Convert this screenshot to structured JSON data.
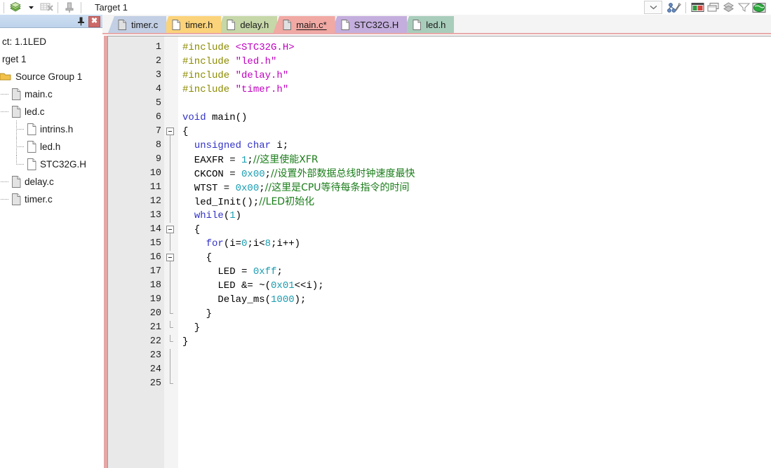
{
  "toolbar": {
    "target_label": "Target 1",
    "buttons": [
      {
        "name": "build-icon",
        "title": "Build"
      },
      {
        "name": "dropdown-arrow-icon",
        "title": "Build options"
      },
      {
        "name": "batch-build-icon",
        "title": "Batch Build"
      },
      {
        "name": "pin-tool-icon",
        "title": "Pin"
      }
    ],
    "right_buttons": [
      {
        "name": "combo-dropdown-icon",
        "title": "Select Target"
      },
      {
        "name": "target-options-icon",
        "title": "Options for Target"
      },
      {
        "name": "project-window-icon",
        "title": "Project Window"
      },
      {
        "name": "books-window-icon",
        "title": "Books Window"
      },
      {
        "name": "functions-window-icon",
        "title": "Functions Window"
      },
      {
        "name": "templates-window-icon",
        "title": "Templates Window"
      },
      {
        "name": "source-browser-icon",
        "title": "Source Browser"
      }
    ]
  },
  "sidebar": {
    "pin_label": "",
    "close_label": "✖",
    "tree": [
      {
        "label": "ct: 1.1LED",
        "indent": 0,
        "icon": "none",
        "connector": "none"
      },
      {
        "label": "rget 1",
        "indent": 0,
        "icon": "none",
        "connector": "none"
      },
      {
        "label": "Source Group 1",
        "indent": 0,
        "icon": "folder",
        "connector": "none"
      },
      {
        "label": "main.c",
        "indent": 1,
        "icon": "doc-src",
        "connector": "expand"
      },
      {
        "label": "led.c",
        "indent": 1,
        "icon": "doc-src",
        "connector": "expand"
      },
      {
        "label": "intrins.h",
        "indent": 2,
        "icon": "doc-hdr",
        "connector": "tee"
      },
      {
        "label": "led.h",
        "indent": 2,
        "icon": "doc-hdr",
        "connector": "tee"
      },
      {
        "label": "STC32G.H",
        "indent": 2,
        "icon": "doc-hdr",
        "connector": "end"
      },
      {
        "label": "delay.c",
        "indent": 1,
        "icon": "doc-src",
        "connector": "expand"
      },
      {
        "label": "timer.c",
        "indent": 1,
        "icon": "doc-src",
        "connector": "expand"
      }
    ]
  },
  "tabs": [
    {
      "label": "timer.c",
      "color": "#c2cfe4",
      "active": false
    },
    {
      "label": "timer.h",
      "color": "#fbd37a",
      "active": false
    },
    {
      "label": "delay.h",
      "color": "#c6d7a8",
      "active": false
    },
    {
      "label": "main.c*",
      "color": "#f1a9a4",
      "active": true
    },
    {
      "label": "STC32G.H",
      "color": "#c4aedd",
      "active": false
    },
    {
      "label": "led.h",
      "color": "#a8cdbb",
      "active": false
    }
  ],
  "editor": {
    "line_count": 25,
    "line_numbers": [
      "1",
      "2",
      "3",
      "4",
      "5",
      "6",
      "7",
      "8",
      "9",
      "10",
      "11",
      "12",
      "13",
      "14",
      "15",
      "16",
      "17",
      "18",
      "19",
      "20",
      "21",
      "22",
      "23",
      "24",
      "25"
    ],
    "fold_marks": {
      "7": "box",
      "8": "v",
      "9": "v",
      "10": "v",
      "11": "v",
      "12": "v",
      "13": "v",
      "14": "box",
      "15": "v",
      "16": "box",
      "17": "v",
      "18": "v",
      "19": "v",
      "20": "end-inner",
      "21": "end-mid",
      "22": "end-outer",
      "23": "v",
      "24": "v",
      "25": "end"
    },
    "lines": [
      {
        "n": 1,
        "tokens": [
          {
            "t": "pre",
            "v": "#include "
          },
          {
            "t": "str",
            "v": "<STC32G.H>"
          }
        ]
      },
      {
        "n": 2,
        "tokens": [
          {
            "t": "pre",
            "v": "#include "
          },
          {
            "t": "str",
            "v": "\"led.h\""
          }
        ]
      },
      {
        "n": 3,
        "tokens": [
          {
            "t": "pre",
            "v": "#include "
          },
          {
            "t": "str",
            "v": "\"delay.h\""
          }
        ]
      },
      {
        "n": 4,
        "tokens": [
          {
            "t": "pre",
            "v": "#include "
          },
          {
            "t": "str",
            "v": "\"timer.h\""
          }
        ]
      },
      {
        "n": 5,
        "tokens": []
      },
      {
        "n": 6,
        "tokens": [
          {
            "t": "kw",
            "v": "void"
          },
          {
            "t": "plain",
            "v": " main()"
          }
        ]
      },
      {
        "n": 7,
        "tokens": [
          {
            "t": "plain",
            "v": "{"
          }
        ]
      },
      {
        "n": 8,
        "tokens": [
          {
            "t": "plain",
            "v": "  "
          },
          {
            "t": "kw",
            "v": "unsigned char"
          },
          {
            "t": "plain",
            "v": " i;"
          }
        ]
      },
      {
        "n": 9,
        "tokens": [
          {
            "t": "plain",
            "v": "  EAXFR = "
          },
          {
            "t": "num",
            "v": "1"
          },
          {
            "t": "plain",
            "v": ";"
          },
          {
            "t": "com",
            "v": "//这里使能XFR"
          }
        ]
      },
      {
        "n": 10,
        "tokens": [
          {
            "t": "plain",
            "v": "  CKCON = "
          },
          {
            "t": "num",
            "v": "0x00"
          },
          {
            "t": "plain",
            "v": ";"
          },
          {
            "t": "com",
            "v": "//设置外部数据总线时钟速度最快"
          }
        ]
      },
      {
        "n": 11,
        "tokens": [
          {
            "t": "plain",
            "v": "  WTST = "
          },
          {
            "t": "num",
            "v": "0x00"
          },
          {
            "t": "plain",
            "v": ";"
          },
          {
            "t": "com",
            "v": "//这里是CPU等待每条指令的时间"
          }
        ]
      },
      {
        "n": 12,
        "tokens": [
          {
            "t": "plain",
            "v": "  led_Init();"
          },
          {
            "t": "com",
            "v": "//LED初始化"
          }
        ]
      },
      {
        "n": 13,
        "tokens": [
          {
            "t": "plain",
            "v": "  "
          },
          {
            "t": "kw",
            "v": "while"
          },
          {
            "t": "plain",
            "v": "("
          },
          {
            "t": "num",
            "v": "1"
          },
          {
            "t": "plain",
            "v": ")"
          }
        ]
      },
      {
        "n": 14,
        "tokens": [
          {
            "t": "plain",
            "v": "  {"
          }
        ]
      },
      {
        "n": 15,
        "tokens": [
          {
            "t": "plain",
            "v": "    "
          },
          {
            "t": "kw",
            "v": "for"
          },
          {
            "t": "plain",
            "v": "(i="
          },
          {
            "t": "num",
            "v": "0"
          },
          {
            "t": "plain",
            "v": ";i<"
          },
          {
            "t": "num",
            "v": "8"
          },
          {
            "t": "plain",
            "v": ";i++)"
          }
        ]
      },
      {
        "n": 16,
        "tokens": [
          {
            "t": "plain",
            "v": "    {"
          }
        ]
      },
      {
        "n": 17,
        "tokens": [
          {
            "t": "plain",
            "v": "      LED = "
          },
          {
            "t": "num",
            "v": "0xff"
          },
          {
            "t": "plain",
            "v": ";"
          }
        ]
      },
      {
        "n": 18,
        "tokens": [
          {
            "t": "plain",
            "v": "      LED &= ~("
          },
          {
            "t": "num",
            "v": "0x01"
          },
          {
            "t": "plain",
            "v": "<<i);"
          }
        ]
      },
      {
        "n": 19,
        "tokens": [
          {
            "t": "plain",
            "v": "      Delay_ms("
          },
          {
            "t": "num",
            "v": "1000"
          },
          {
            "t": "plain",
            "v": ");"
          }
        ]
      },
      {
        "n": 20,
        "tokens": [
          {
            "t": "plain",
            "v": "    }"
          }
        ]
      },
      {
        "n": 21,
        "tokens": [
          {
            "t": "plain",
            "v": "  }"
          }
        ]
      },
      {
        "n": 22,
        "tokens": [
          {
            "t": "plain",
            "v": "}"
          }
        ]
      },
      {
        "n": 23,
        "tokens": []
      },
      {
        "n": 24,
        "tokens": []
      },
      {
        "n": 25,
        "tokens": []
      }
    ]
  },
  "colors": {
    "preprocessor": "#8b8b00",
    "string": "#c000c0",
    "keyword": "#3232c8",
    "number": "#1a9cb0",
    "comment": "#1a7d1a",
    "plain": "#000000",
    "active_tab": "#f1a9a4",
    "editor_border": "#e6a6a6",
    "gutter_bg": "#e9e9e9"
  }
}
